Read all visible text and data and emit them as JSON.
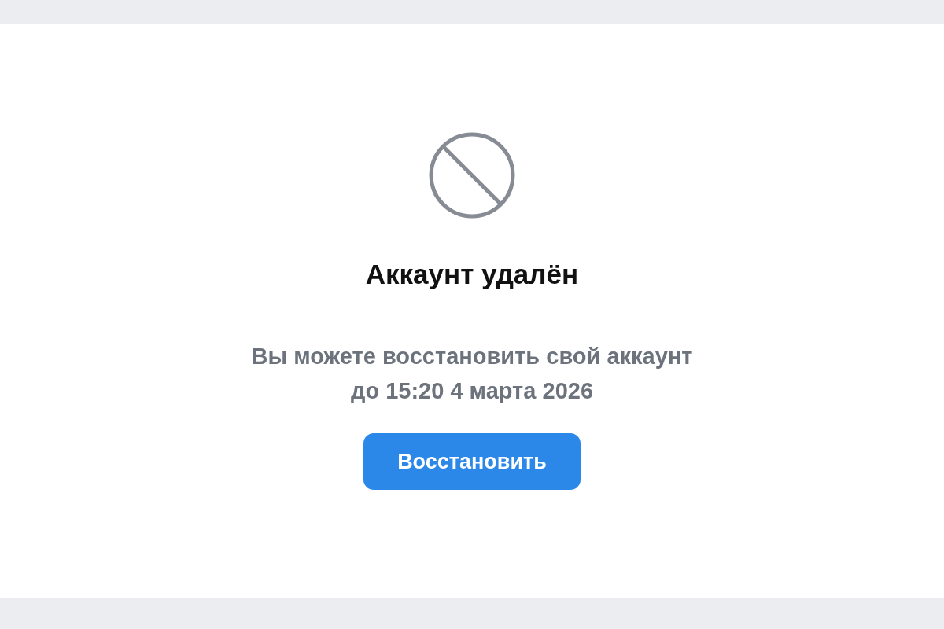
{
  "notice": {
    "title": "Аккаунт удалён",
    "message": "Вы можете восстановить свой аккаунт\nдо 15:20 4 марта 2026",
    "button": "Восстановить"
  }
}
